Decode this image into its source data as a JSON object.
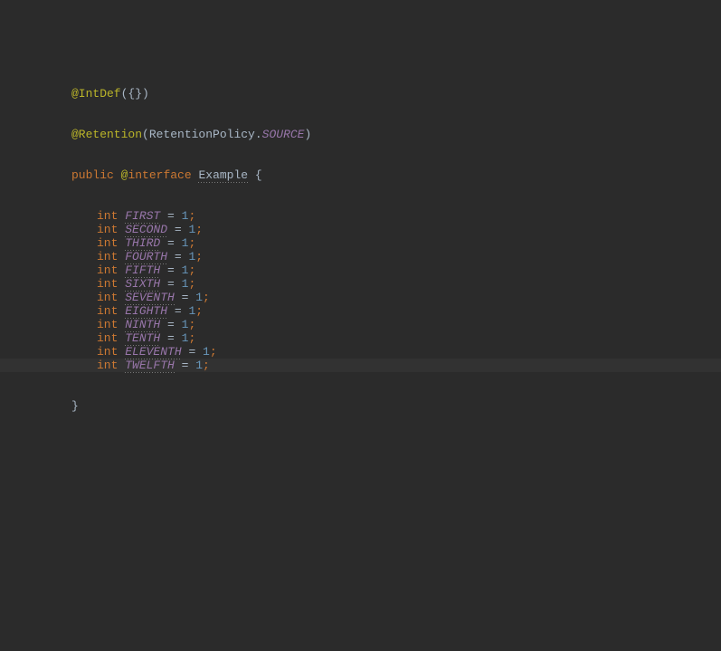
{
  "annotations": {
    "intdef": {
      "name": "@IntDef",
      "args_open": "(",
      "args_body": "{}",
      "args_close": ")"
    },
    "retention": {
      "name": "@Retention",
      "args_open": "(",
      "policy_class": "RetentionPolicy",
      "dot": ".",
      "policy_value": "SOURCE",
      "args_close": ")"
    }
  },
  "decl": {
    "modifier": "public",
    "at": "@",
    "kind": "interface",
    "name": "Example",
    "open": " {"
  },
  "fields": [
    {
      "type": "int",
      "name": "FIRST",
      "eq": " = ",
      "value": "1",
      "semi": ";"
    },
    {
      "type": "int",
      "name": "SECOND",
      "eq": " = ",
      "value": "1",
      "semi": ";"
    },
    {
      "type": "int",
      "name": "THIRD",
      "eq": " = ",
      "value": "1",
      "semi": ";"
    },
    {
      "type": "int",
      "name": "FOURTH",
      "eq": " = ",
      "value": "1",
      "semi": ";"
    },
    {
      "type": "int",
      "name": "FIFTH",
      "eq": " = ",
      "value": "1",
      "semi": ";"
    },
    {
      "type": "int",
      "name": "SIXTH",
      "eq": " = ",
      "value": "1",
      "semi": ";"
    },
    {
      "type": "int",
      "name": "SEVENTH",
      "eq": " = ",
      "value": "1",
      "semi": ";"
    },
    {
      "type": "int",
      "name": "EIGHTH",
      "eq": " = ",
      "value": "1",
      "semi": ";"
    },
    {
      "type": "int",
      "name": "NINTH",
      "eq": " = ",
      "value": "1",
      "semi": ";"
    },
    {
      "type": "int",
      "name": "TENTH",
      "eq": " = ",
      "value": "1",
      "semi": ";"
    },
    {
      "type": "int",
      "name": "ELEVENTH",
      "eq": " = ",
      "value": "1",
      "semi": ";"
    },
    {
      "type": "int",
      "name": "TWELFTH",
      "eq": " = ",
      "value": "1",
      "semi": ";"
    }
  ],
  "close": "}"
}
